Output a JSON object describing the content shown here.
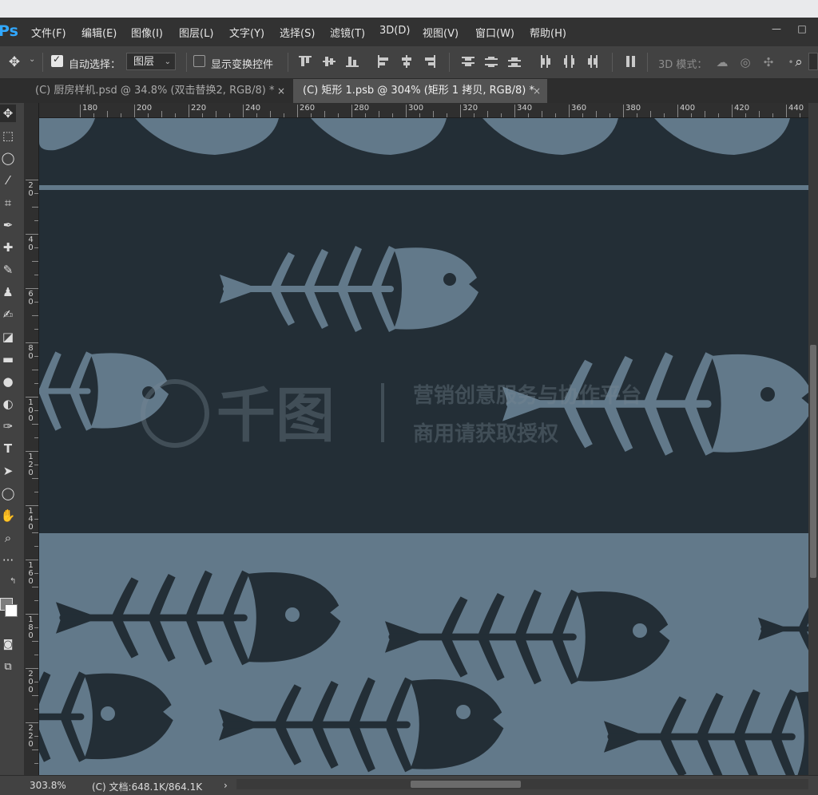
{
  "app": {
    "logo": "Ps",
    "menu": [
      "文件(F)",
      "编辑(E)",
      "图像(I)",
      "图层(L)",
      "文字(Y)",
      "选择(S)",
      "滤镜(T)",
      "3D(D)",
      "视图(V)",
      "窗口(W)",
      "帮助(H)"
    ],
    "window_buttons": [
      "—",
      "□"
    ]
  },
  "options": {
    "auto_select_label": "自动选择：",
    "auto_select_checked": true,
    "layer_select_value": "图层",
    "show_transform_label": "显示变换控件",
    "show_transform_checked": false,
    "mode_3d_label": "3D 模式："
  },
  "tabs": [
    {
      "label": "(C) 厨房样机.psd @ 34.8% (双击替换2, RGB/8) *",
      "close": "×",
      "active": false
    },
    {
      "label": "(C) 矩形 1.psb @ 304% (矩形 1 拷贝, RGB/8) *",
      "close": "×",
      "active": true
    }
  ],
  "ruler": {
    "h_labels": [
      "180",
      "200",
      "220",
      "240",
      "260",
      "280",
      "300",
      "320",
      "340",
      "360",
      "380",
      "400",
      "420",
      "440"
    ],
    "v_labels": [
      "2 0",
      "4 0",
      "6 0",
      "8 0",
      "1 0 0",
      "1 2 0",
      "1 4 0",
      "1 6 0",
      "1 8 0",
      "2 0 0",
      "2 2 0"
    ]
  },
  "status": {
    "zoom": "303.8%",
    "doc_info": "(C) 文档:648.1K/864.1K",
    "arrow": "›"
  },
  "watermark": {
    "brand": "千图",
    "line1": "营销创意服务与协作平台",
    "line2": "商用请获取授权"
  },
  "colors": {
    "dark_band": "#232e36",
    "light_band": "#62798a",
    "fish_light": "#62798a",
    "fish_dark": "#232e36"
  }
}
